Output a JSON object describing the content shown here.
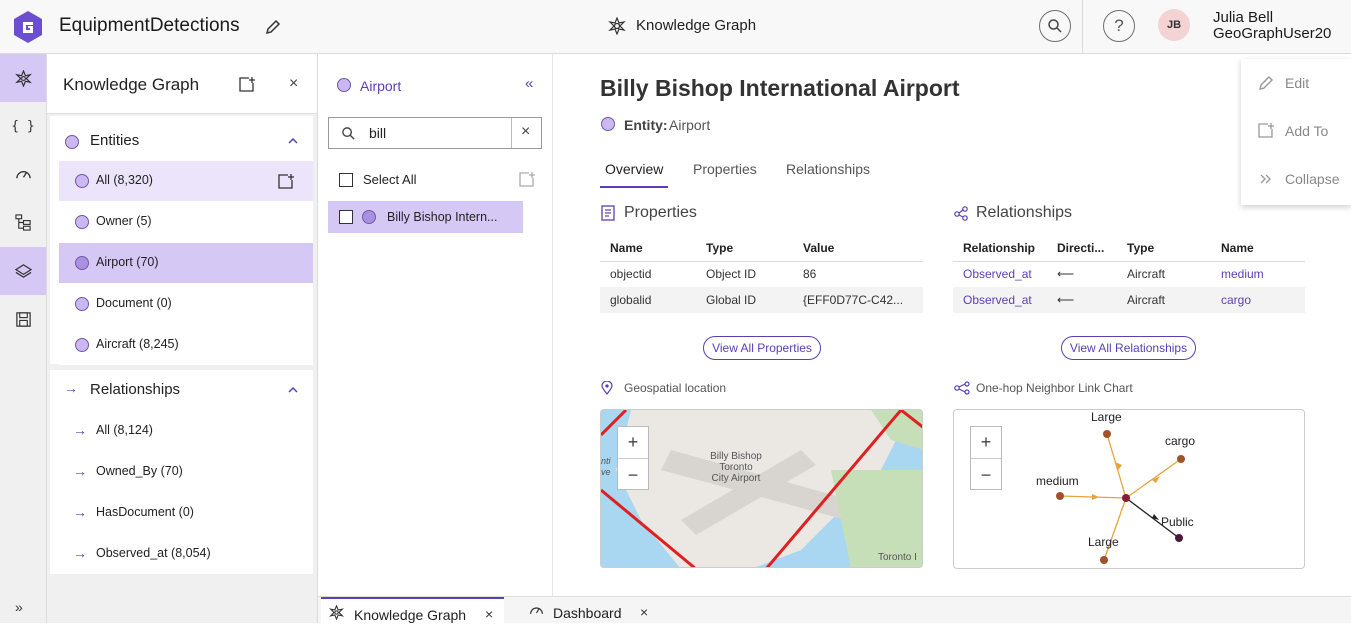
{
  "header": {
    "app_title": "EquipmentDetections",
    "center_title": "Knowledge Graph",
    "user_initials": "JB",
    "user_name": "Julia Bell",
    "user_id": "GeoGraphUser20"
  },
  "rail": {
    "items": [
      "knowledge-graph",
      "code",
      "dashboard",
      "hierarchy",
      "layers",
      "save"
    ],
    "expand_label": "»"
  },
  "panel1": {
    "title": "Knowledge Graph",
    "entities_label": "Entities",
    "entities": [
      {
        "label": "All (8,320)"
      },
      {
        "label": "Owner (5)"
      },
      {
        "label": "Airport (70)"
      },
      {
        "label": "Document (0)"
      },
      {
        "label": "Aircraft (8,245)"
      }
    ],
    "relationships_label": "Relationships",
    "relationships": [
      {
        "label": "All (8,124)"
      },
      {
        "label": "Owned_By (70)"
      },
      {
        "label": "HasDocument (0)"
      },
      {
        "label": "Observed_at (8,054)"
      }
    ]
  },
  "panel2": {
    "title": "Airport",
    "search_value": "bill",
    "select_all": "Select All",
    "results": [
      "Billy Bishop Intern..."
    ]
  },
  "detail": {
    "title": "Billy Bishop International Airport",
    "entity_key": "Entity:",
    "entity_value": "Airport",
    "tabs": [
      "Overview",
      "Properties",
      "Relationships"
    ],
    "properties_title": "Properties",
    "properties_columns": [
      "Name",
      "Type",
      "Value"
    ],
    "properties_rows": [
      [
        "objectid",
        "Object ID",
        "86"
      ],
      [
        "globalid",
        "Global ID",
        "{EFF0D77C-C42..."
      ]
    ],
    "view_all_properties": "View All Properties",
    "relationships_title": "Relationships",
    "relationships_columns": [
      "Relationship",
      "Directi...",
      "Type",
      "Name"
    ],
    "relationships_rows": [
      [
        "Observed_at",
        "⟵",
        "Aircraft",
        "medium"
      ],
      [
        "Observed_at",
        "⟵",
        "Aircraft",
        "cargo"
      ]
    ],
    "view_all_relationships": "View All Relationships",
    "geo_title": "Geospatial location",
    "map_label_1": "Billy Bishop",
    "map_label_2": "Toronto",
    "map_label_3": "City Airport",
    "map_label_4": "Toronto I",
    "map_edge_1": "nti",
    "map_edge_2": "ve",
    "linkchart_title": "One-hop Neighbor Link Chart",
    "linkchart_nodes": [
      "Large",
      "cargo",
      "medium",
      "Public",
      "Large"
    ],
    "zoom_in": "+",
    "zoom_out": "−"
  },
  "actions": {
    "items": [
      "Edit",
      "Add To",
      "Collapse"
    ]
  },
  "bottom_tabs": [
    "Knowledge Graph",
    "Dashboard"
  ],
  "colors": {
    "accent": "#5b3fb5",
    "selected": "#d6c8f5",
    "node_orange": "#a0522d",
    "edge_orange": "#e8a23a"
  }
}
